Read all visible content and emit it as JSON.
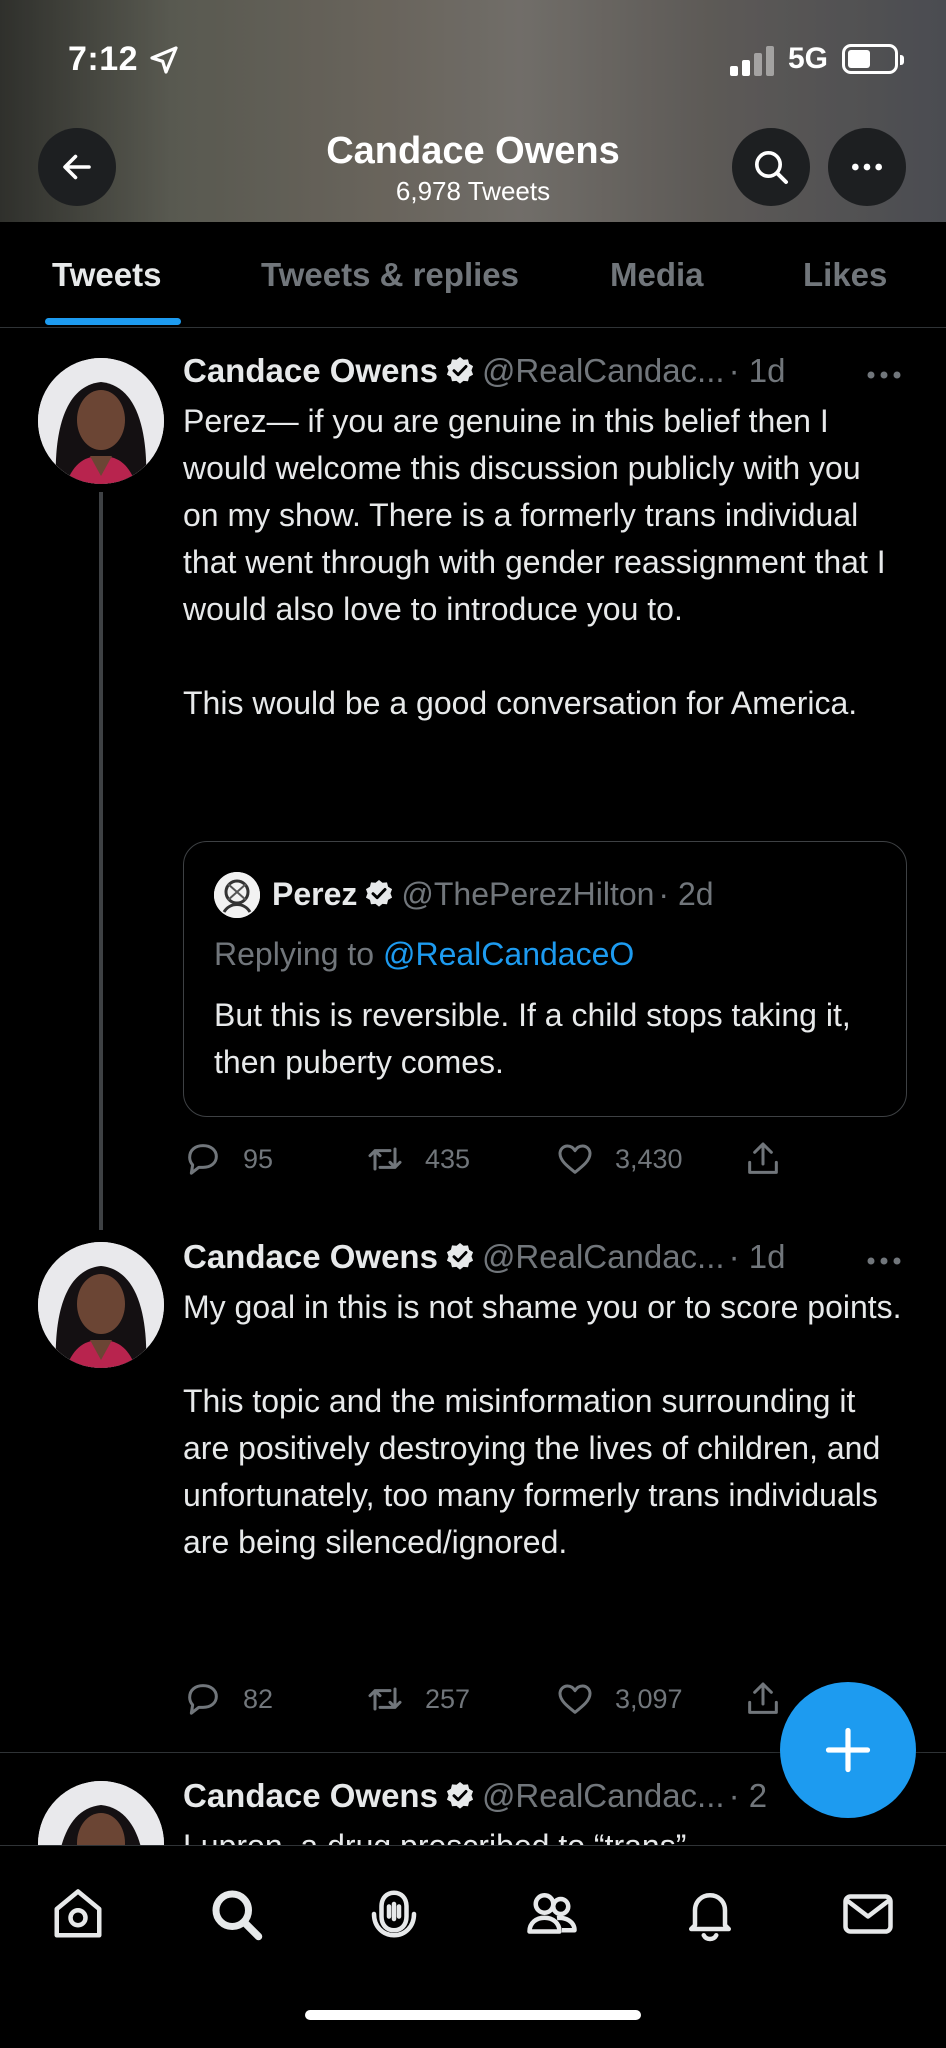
{
  "status_bar": {
    "time": "7:12",
    "network": "5G"
  },
  "header": {
    "title": "Candace Owens",
    "subtitle": "6,978 Tweets"
  },
  "tabs": [
    {
      "label": "Tweets",
      "active": true
    },
    {
      "label": "Tweets & replies",
      "active": false
    },
    {
      "label": "Media",
      "active": false
    },
    {
      "label": "Likes",
      "active": false
    }
  ],
  "tweets": [
    {
      "name": "Candace Owens",
      "handle": "@RealCandac...",
      "time": "· 1d",
      "text": "Perez— if you are genuine in this belief then I would welcome this discussion publicly with you on my show. There is a formerly trans individual that went through with gender reassignment that I would also love to introduce you to.\n\nThis would be a good conversation for America.",
      "quote": {
        "name": "Perez",
        "handle": "@ThePerezHilton",
        "time": "· 2d",
        "replying_prefix": "Replying to",
        "replying_to": "@RealCandaceO",
        "text": "But this is reversible. If a child stops taking it, then puberty comes."
      },
      "replies": "95",
      "retweets": "435",
      "likes": "3,430"
    },
    {
      "name": "Candace Owens",
      "handle": "@RealCandac...",
      "time": "· 1d",
      "text": "My goal in this is not shame you or to score points.\n\nThis topic and the misinformation surrounding it are positively destroying the lives of children, and unfortunately, too many formerly trans individuals are being silenced/ignored.",
      "replies": "82",
      "retweets": "257",
      "likes": "3,097"
    },
    {
      "name": "Candace Owens",
      "handle": "@RealCandac...",
      "time": "· 2",
      "text": "Lupron, a drug prescribed to “trans”"
    }
  ],
  "bottom_nav": [
    "home-icon",
    "search-icon",
    "spaces-icon",
    "communities-icon",
    "notifications-icon",
    "messages-icon"
  ],
  "colors": {
    "accent": "#1d9bf0",
    "background": "#000000",
    "secondary_text": "#71767b",
    "divider": "#2f3336"
  }
}
